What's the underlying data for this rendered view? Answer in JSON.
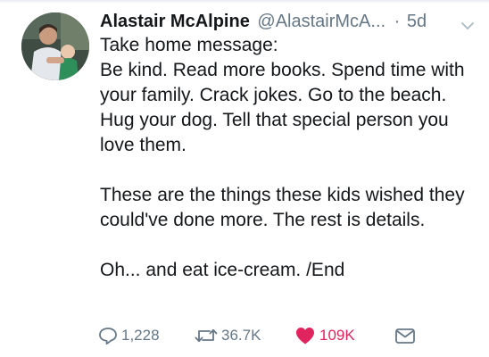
{
  "tweet": {
    "author_name": "Alastair McAlpine",
    "author_handle": "@AlastairMcA...",
    "separator": "·",
    "timestamp": "5d",
    "text_lines": [
      "Take home message:",
      "Be kind. Read more books. Spend time with your family. Crack jokes. Go to the beach. Hug your dog. Tell that special person you love them.",
      "These are the things these kids wished they could've done more. The rest is details.",
      "Oh... and eat ice-cream. /End"
    ]
  },
  "actions": {
    "reply_count": "1,228",
    "retweet_count": "36.7K",
    "like_count": "109K"
  },
  "icons": {
    "reply": "reply-icon",
    "retweet": "retweet-icon",
    "like": "heart-icon",
    "dm": "envelope-icon",
    "menu": "chevron-down-icon"
  },
  "colors": {
    "text": "#14171a",
    "muted": "#657786",
    "like": "#e0245e"
  }
}
